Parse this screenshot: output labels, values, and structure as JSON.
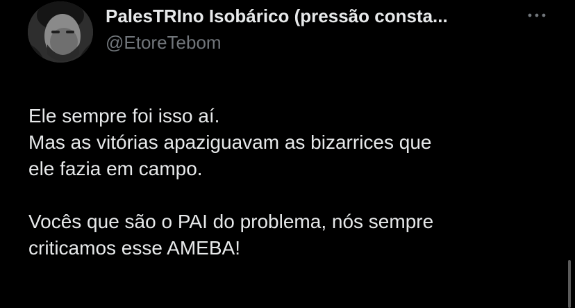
{
  "author": {
    "display_name": "PalesTRIno Isobárico (pressão consta...",
    "handle": "@EtoreTebom",
    "avatar_icon": "user-avatar"
  },
  "menu": {
    "icon": "more-horizontal-icon"
  },
  "tweet": {
    "lines": [
      "Ele sempre foi isso aí.",
      "Mas as vitórias apaziguavam as bizarrices que",
      "ele fazia em campo.",
      "Vocês que são o PAI do problema, nós sempre",
      "criticamos esse AMEBA!"
    ]
  },
  "colors": {
    "background": "#000000",
    "primary_text": "#e7e9ea",
    "secondary_text": "#71767b"
  }
}
